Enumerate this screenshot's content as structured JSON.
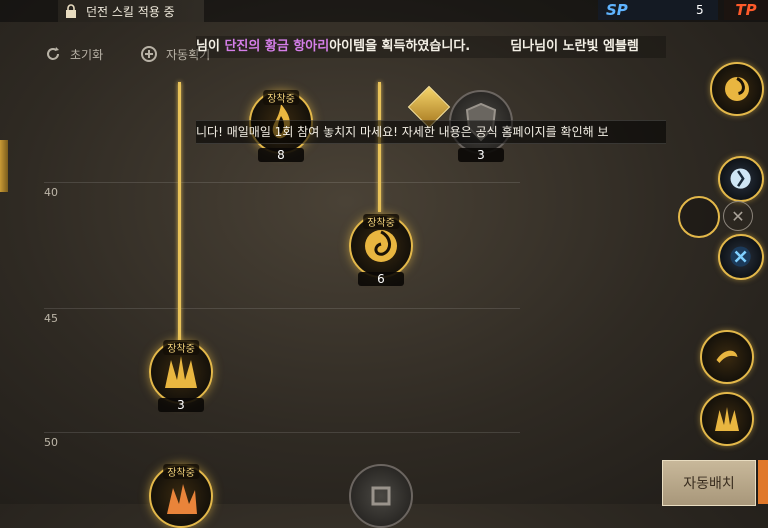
{
  "top_bar": {
    "dungeon_status": "던전 스킬 적용 중",
    "sp_label": "SP",
    "sp_value": "5",
    "tp_label": "TP"
  },
  "ticker": {
    "prefix": "님이 ",
    "highlight": "단진의 황금 항아리",
    "suffix": "아이템을 획득하였습니다.",
    "next": "딤나님이 노란빛 엠블렘"
  },
  "notice": {
    "text": "니다! 매일매일 1회 참여 놓치지 마세요! 자세한 내용은 공식 홈페이지를 확인해 보"
  },
  "controls": {
    "reset_label": "초기화",
    "auto_label": "자동획기"
  },
  "level_markers": [
    "40",
    "45",
    "50"
  ],
  "skills": [
    {
      "equip": "장착중",
      "level": "8"
    },
    {
      "level": "3"
    },
    {
      "equip": "장착중",
      "level": "6"
    },
    {
      "equip": "장착중",
      "level": "3"
    },
    {
      "equip": "장착중"
    }
  ],
  "auto_place_button": "자동배치",
  "colors": {
    "accent_gold": "#e3b84a",
    "sp_blue": "#5fb4ff",
    "tp_red": "#ff5a2a",
    "ticker_highlight": "#d47ee8"
  }
}
